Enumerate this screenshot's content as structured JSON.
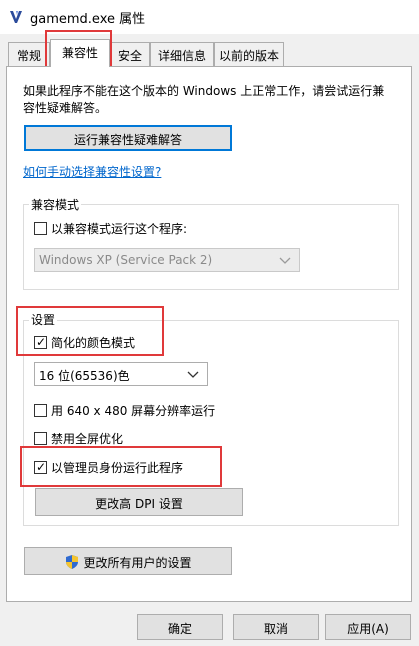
{
  "window": {
    "title": "gamemd.exe 属性"
  },
  "tabs": [
    {
      "label": "常规"
    },
    {
      "label": "兼容性"
    },
    {
      "label": "安全"
    },
    {
      "label": "详细信息"
    },
    {
      "label": "以前的版本"
    }
  ],
  "compat": {
    "intro_line1": "如果此程序不能在这个版本的 Windows 上正常工作，请尝试运行兼",
    "intro_line2": "容性疑难解答。",
    "troubleshooter_button": "运行兼容性疑难解答",
    "manual_link": "如何手动选择兼容性设置?",
    "compat_mode": {
      "group_label": "兼容模式",
      "checkbox_label": "以兼容模式运行这个程序:",
      "checked": false,
      "os_select_value": "Windows XP (Service Pack 2)"
    },
    "settings": {
      "group_label": "设置",
      "reduced_color_label": "简化的颜色模式",
      "reduced_color_checked": true,
      "color_select_value": "16 位(65536)色",
      "resolution_label": "用 640 x 480 屏幕分辨率运行",
      "resolution_checked": false,
      "fullscreen_label": "禁用全屏优化",
      "fullscreen_checked": false,
      "admin_label": "以管理员身份运行此程序",
      "admin_checked": true,
      "dpi_button": "更改高 DPI 设置"
    },
    "all_users_button": "更改所有用户的设置"
  },
  "footer": {
    "ok": "确定",
    "cancel": "取消",
    "apply": "应用(A)"
  },
  "colors": {
    "highlight": "#e0393a",
    "link": "#0066cc",
    "focus": "#0078d7"
  },
  "icons": {
    "app": "app-icon",
    "shield": "uac-shield-icon",
    "checkmark": "checkmark-icon",
    "chevron": "chevron-down-icon"
  }
}
